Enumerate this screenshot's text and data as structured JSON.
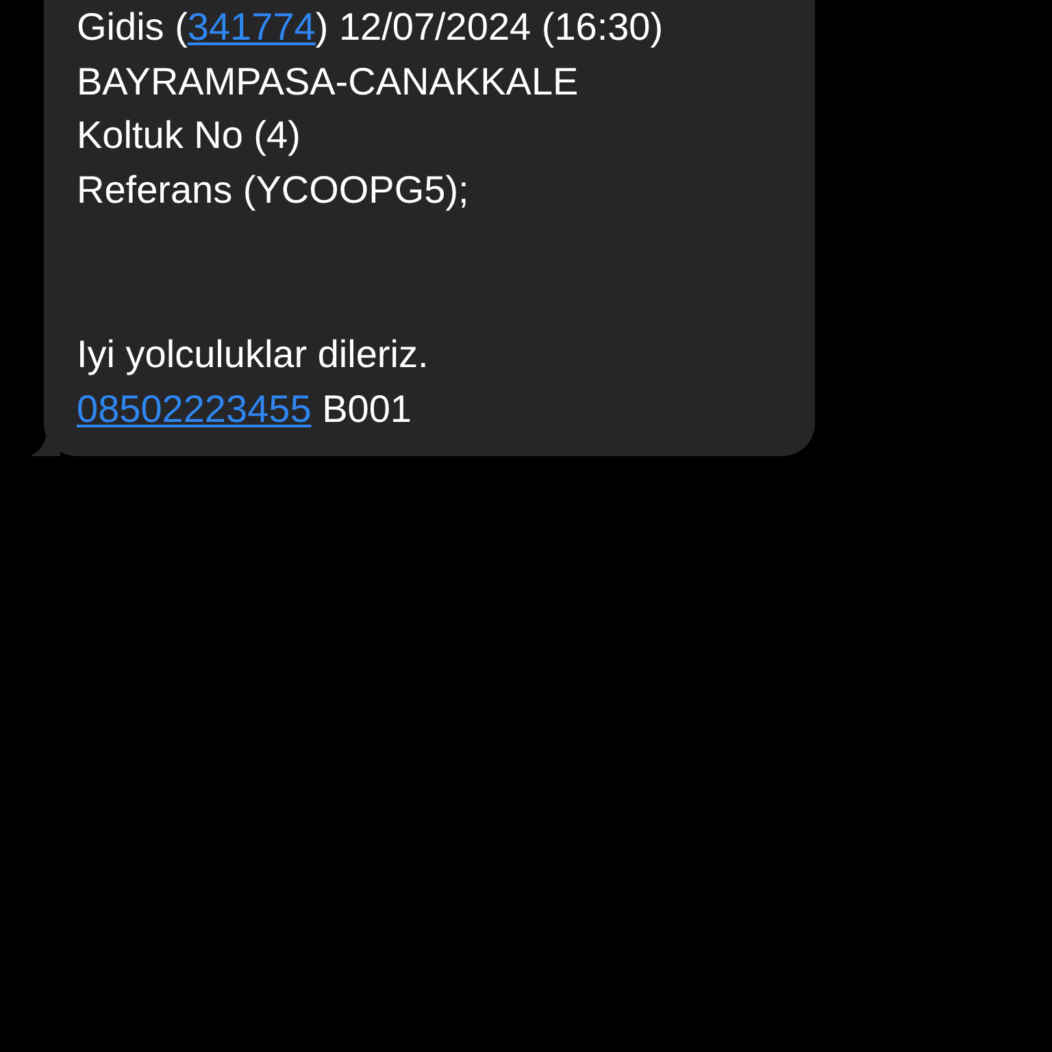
{
  "message": {
    "paragraphs": [
      [
        {
          "segments": [
            {
              "kind": "text",
              "text": "Gidis ("
            },
            {
              "kind": "link",
              "text": "341774"
            },
            {
              "kind": "text",
              "text": ") 12/07/2024 (16:30)"
            }
          ]
        },
        {
          "segments": [
            {
              "kind": "text",
              "text": "BAYRAMPASA-CANAKKALE"
            }
          ]
        },
        {
          "segments": [
            {
              "kind": "text",
              "text": "Koltuk No (4)"
            }
          ]
        },
        {
          "segments": [
            {
              "kind": "text",
              "text": "Referans (YCOOPG5);"
            }
          ]
        }
      ],
      [
        {
          "segments": [
            {
              "kind": "text",
              "text": "Iyi yolculuklar dileriz."
            }
          ]
        },
        {
          "segments": [
            {
              "kind": "link",
              "text": "08502223455"
            },
            {
              "kind": "text",
              "text": " B001"
            }
          ]
        }
      ]
    ]
  }
}
